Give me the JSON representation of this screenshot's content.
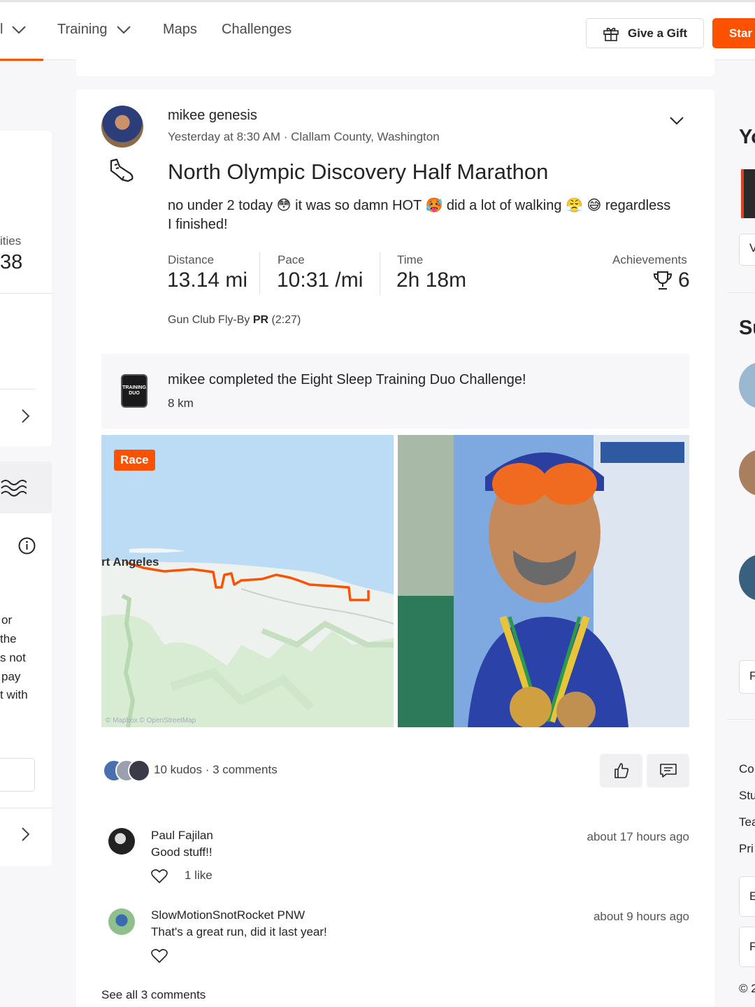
{
  "nav": {
    "partial_item": "l",
    "training": "Training",
    "maps": "Maps",
    "challenges": "Challenges",
    "give_gift": "Give a Gift",
    "start": "Star"
  },
  "left_sidebar": {
    "activities_label": "ities",
    "activities_count": "38",
    "partial_lines": [
      "or",
      "the",
      "s not",
      "pay",
      "t with"
    ]
  },
  "post": {
    "athlete": "mikee genesis",
    "meta": "Yesterday at 8:30 AM · Clallam County, Washington",
    "title": "North Olympic Discovery Half Marathon",
    "description_line1": "no under 2 today 😳 it was so damn HOT 🥵 did a lot of walking 😤 😅 regardless",
    "description_line2": "I finished!",
    "stats": {
      "distance_label": "Distance",
      "distance_value": "13.14 mi",
      "pace_label": "Pace",
      "pace_value": "10:31 /mi",
      "time_label": "Time",
      "time_value": "2h 18m",
      "achievements_label": "Achievements",
      "achievements_value": "6"
    },
    "segment_name": "Gun Club Fly-By",
    "segment_pr": "PR",
    "segment_time": "(2:27)",
    "challenge": {
      "text": "mikee completed the Eight Sleep Training Duo Challenge!",
      "distance": "8 km",
      "badge_text": "TRAINING DUO"
    },
    "map": {
      "tag": "Race",
      "city_label": "rt Angeles",
      "attribution": "© Mapbox © OpenStreetMap"
    },
    "kudos_text": "10 kudos · 3 comments",
    "comments": [
      {
        "name": "Paul Fajilan",
        "body": "Good stuff!!",
        "time": "about 17 hours ago",
        "likes": "1 like"
      },
      {
        "name": "SlowMotionSnotRocket PNW",
        "body": "That's a great run, did it last year!",
        "time": "about 9 hours ago",
        "likes": ""
      }
    ],
    "see_all": "See all 3 comments"
  },
  "right_sidebar": {
    "heading1": "Yo",
    "heading2": "Su",
    "box1": "V",
    "box2": "F",
    "links": [
      "Co",
      "Stu",
      "Tea",
      "Pri"
    ],
    "box3": "E",
    "box4": "F",
    "copyright": "© 2"
  },
  "colors": {
    "brand": "#fc5200",
    "route": "#fc5200",
    "water": "#b9dcf7",
    "land": "#d9efd5"
  }
}
